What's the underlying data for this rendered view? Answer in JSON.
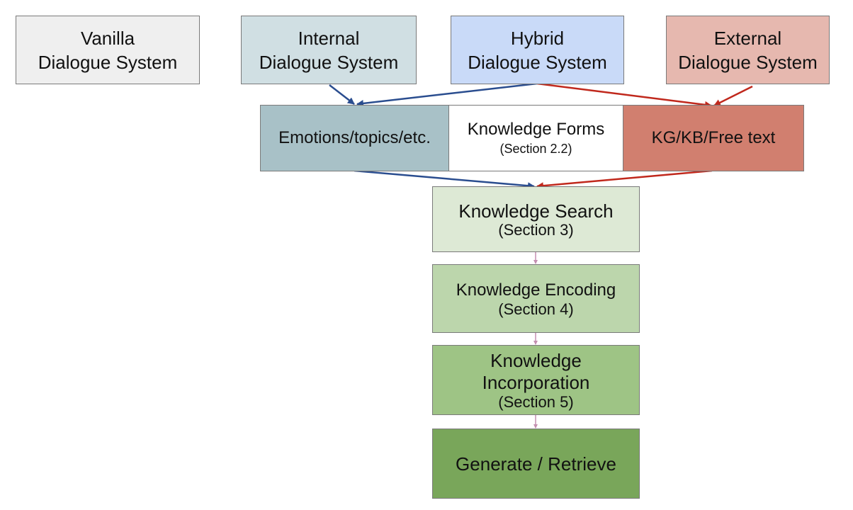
{
  "systems": [
    {
      "line1": "Vanilla",
      "line2": "Dialogue System",
      "color": "#efefef"
    },
    {
      "line1": "Internal",
      "line2": "Dialogue System",
      "color": "#d0dfe3"
    },
    {
      "line1": "Hybrid",
      "line2": "Dialogue System",
      "color": "#c9daf8"
    },
    {
      "line1": "External",
      "line2": "Dialogue System",
      "color": "#e6b8af"
    }
  ],
  "forms": {
    "internal": {
      "label": "Emotions/topics/etc.",
      "color": "#a8c1c7"
    },
    "center": {
      "label": "Knowledge Forms",
      "section": "(Section 2.2)",
      "color": "#ffffff"
    },
    "external": {
      "label": "KG/KB/Free text",
      "color": "#d17f6f"
    }
  },
  "pipeline": [
    {
      "label": "Knowledge Search",
      "section": "(Section 3)",
      "color": "#dde9d5"
    },
    {
      "label": "Knowledge Encoding",
      "section": "(Section 4)",
      "color": "#bcd6ac"
    },
    {
      "label": "Knowledge Incorporation",
      "section": "(Section 5)",
      "color": "#9ec485"
    },
    {
      "label": "Generate / Retrieve",
      "color": "#79a65a"
    }
  ],
  "arrow_colors": {
    "internal": "#2a4d8f",
    "external": "#c0281c",
    "pipeline": "#c48fb0"
  }
}
